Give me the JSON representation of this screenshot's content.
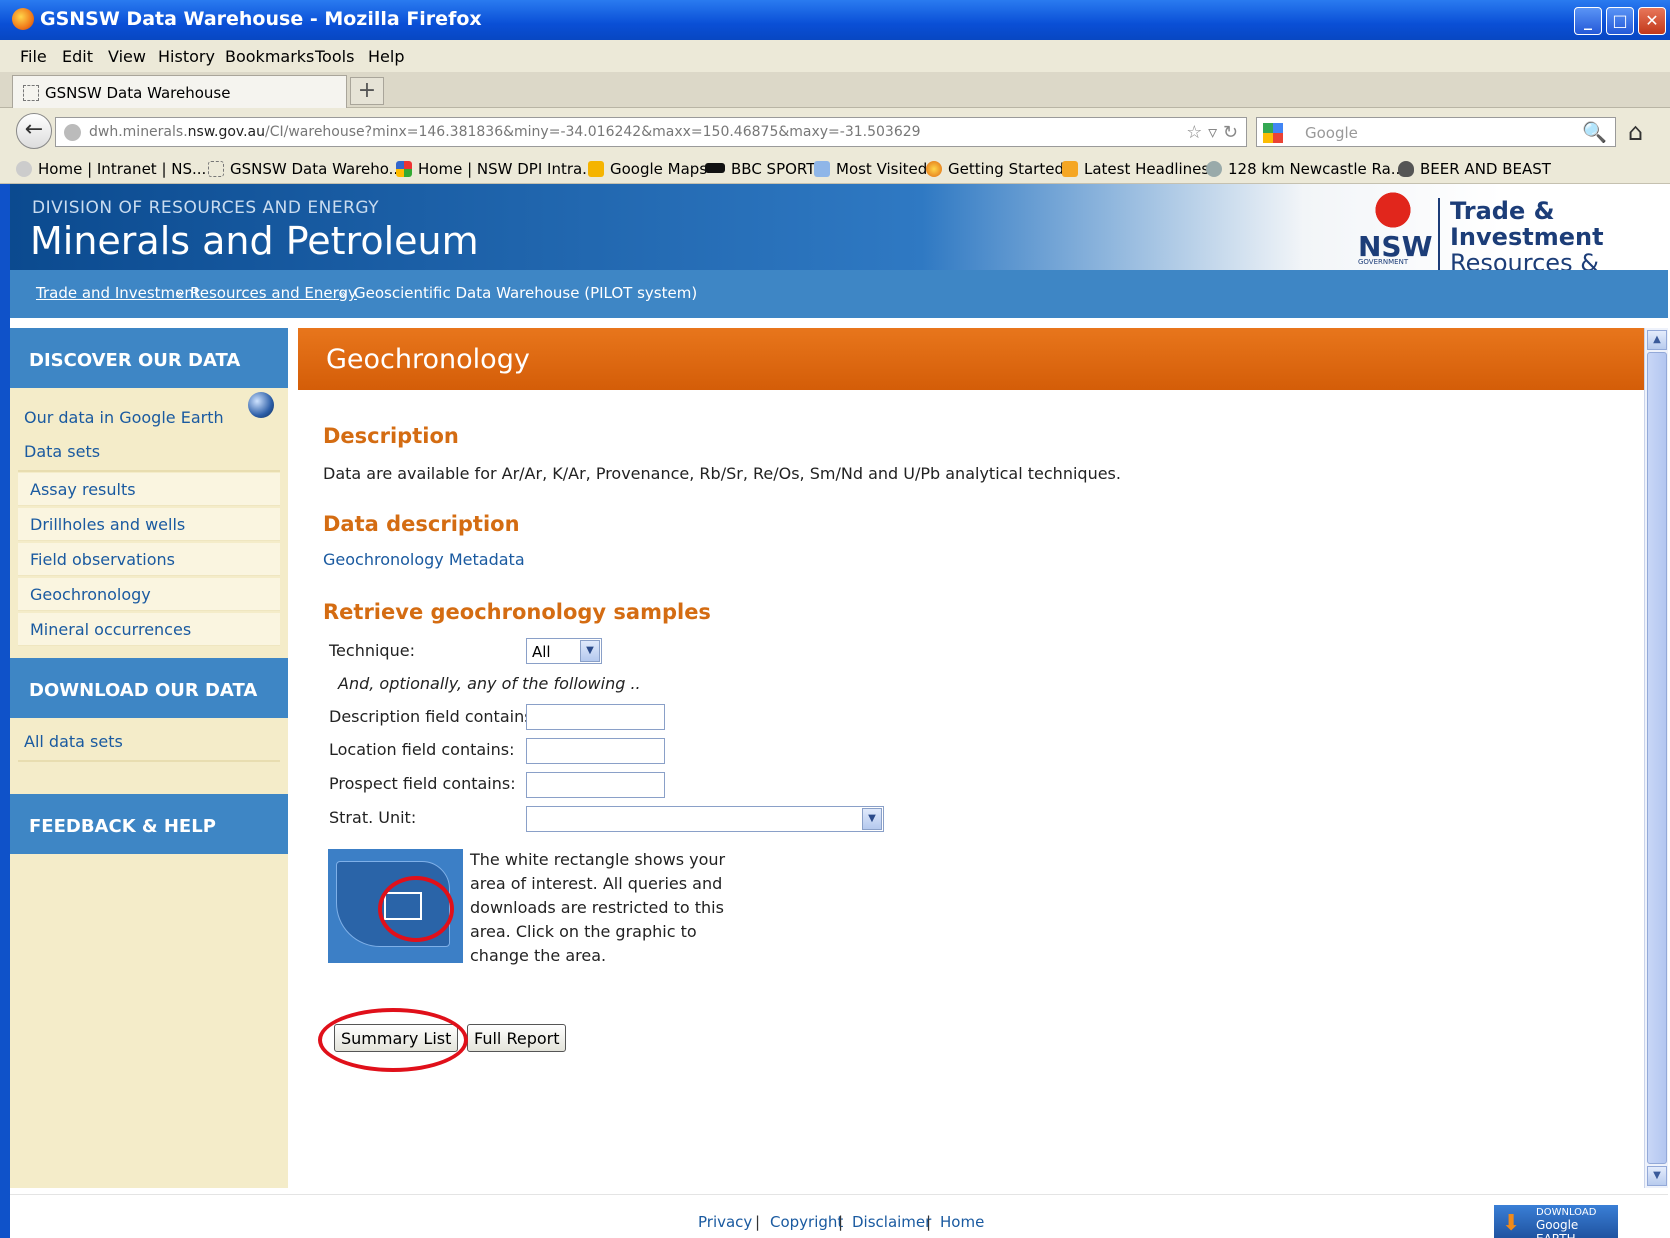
{
  "window": {
    "title": "GSNSW Data Warehouse - Mozilla Firefox",
    "minimize_label": "_",
    "maximize_label": "□",
    "close_label": "✕"
  },
  "menu": [
    "File",
    "Edit",
    "View",
    "History",
    "Bookmarks",
    "Tools",
    "Help"
  ],
  "tab": {
    "label": "GSNSW Data Warehouse",
    "new_tab_label": "+"
  },
  "nav": {
    "back_label": "←",
    "url_prefix": "dwh.minerals.",
    "url_domain": "nsw.gov.au",
    "url_rest": "/CI/warehouse?minx=146.381836&miny=-34.016242&maxx=150.46875&maxy=-31.503629",
    "url_icons": "☆ ▿ ↻",
    "search_placeholder": "Google",
    "search_icon": "🔍",
    "home_icon": "⌂"
  },
  "bookmarks": [
    "Home | Intranet | NS...",
    "GSNSW Data Wareho...",
    "Home | NSW DPI Intra...",
    "Google Maps",
    "BBC SPORT",
    "Most Visited",
    "Getting Started",
    "Latest Headlines",
    "128 km Newcastle Ra...",
    "BEER AND BEAST"
  ],
  "header": {
    "division": "DIVISION OF RESOURCES AND ENERGY",
    "title": "Minerals and Petroleum",
    "nsw": "NSW",
    "gov": "GOVERNMENT",
    "agency_line1": "Trade &",
    "agency_line2": "Investment",
    "agency_line3": "Resources & Energy"
  },
  "breadcrumb": {
    "items": [
      "Trade and Investment",
      "Resources and Energy",
      "Geoscientific Data Warehouse (PILOT system)"
    ],
    "separator": "»"
  },
  "sidebar": {
    "discover_heading": "DISCOVER OUR DATA",
    "google_earth_link": "Our data in Google Earth",
    "data_sets_link": "Data sets",
    "data_set_items": [
      "Assay results",
      "Drillholes and wells",
      "Field observations",
      "Geochronology",
      "Mineral occurrences"
    ],
    "download_heading": "DOWNLOAD OUR DATA",
    "all_data_sets_link": "All data sets",
    "feedback_heading": "FEEDBACK & HELP"
  },
  "content": {
    "page_title": "Geochronology",
    "description_heading": "Description",
    "description_text": "Data are available for Ar/Ar, K/Ar, Provenance, Rb/Sr, Re/Os, Sm/Nd and U/Pb analytical techniques.",
    "data_description_heading": "Data description",
    "metadata_link": "Geochronology Metadata",
    "retrieve_heading": "Retrieve geochronology samples",
    "technique_label": "Technique:",
    "technique_value": "All",
    "optional_note": "And, optionally, any of the following ..",
    "description_field_label": "Description field contains:",
    "location_field_label": "Location field contains:",
    "prospect_field_label": "Prospect field contains:",
    "strat_unit_label": "Strat. Unit:",
    "strat_unit_value": "",
    "map_text": "The white rectangle shows your area of interest. All queries and downloads are restricted to this area. Click on the graphic to change the area.",
    "summary_button": "Summary List",
    "full_report_button": "Full Report"
  },
  "footer": {
    "links": [
      "Privacy",
      "Copyright",
      "Disclaimer",
      "Home"
    ],
    "separator": "|",
    "download_badge_top": "DOWNLOAD",
    "download_badge_bottom": "Google EARTH"
  },
  "scrollbar": {
    "up_label": "▲",
    "down_label": "▼"
  },
  "dropdown_arrow": "▼",
  "colors": {
    "accent_orange": "#d46c12",
    "brand_blue": "#3e86c5",
    "sidebar_bg": "#f4ecc9",
    "link_blue": "#1a5aa0",
    "annotation_red": "#e0101a"
  }
}
